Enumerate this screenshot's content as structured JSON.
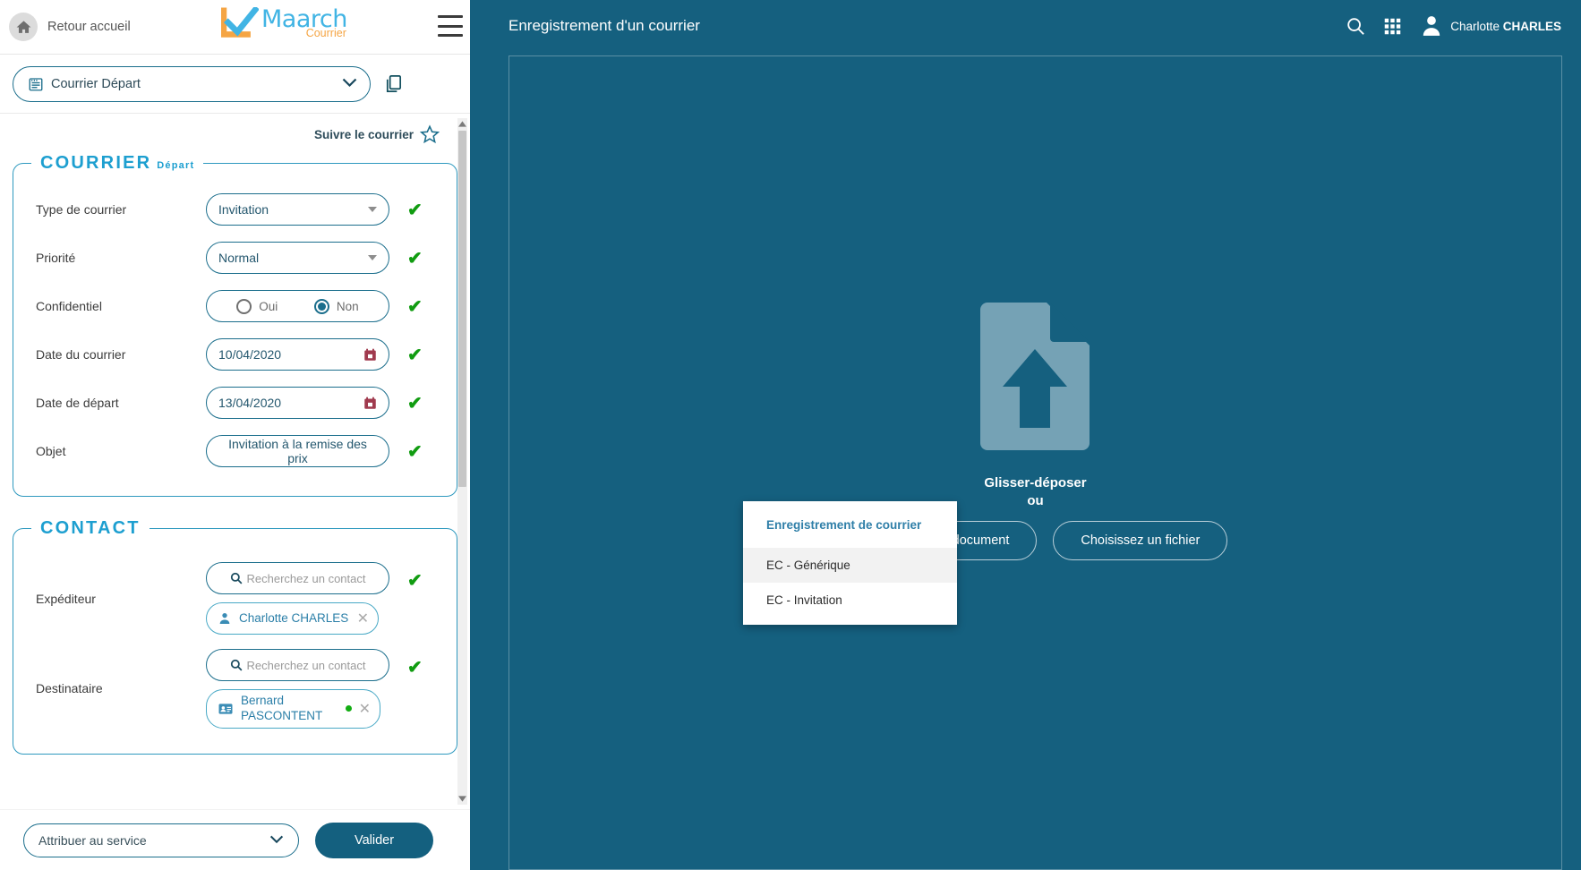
{
  "left_panel": {
    "home_button_label": "Retour accueil",
    "logo": {
      "brand": "Maarch",
      "sub": "Courrier"
    },
    "type_selector": {
      "value": "Courrier Départ"
    },
    "follow": {
      "label": "Suivre le courrier"
    },
    "sections": [
      {
        "title": "COURRIER",
        "subtitle": "Départ",
        "fields": [
          {
            "label": "Type de courrier",
            "kind": "select",
            "value": "Invitation",
            "valid": "✔"
          },
          {
            "label": "Priorité",
            "kind": "select",
            "value": "Normal",
            "valid": "✔"
          },
          {
            "label": "Confidentiel",
            "kind": "radio",
            "options": [
              "Oui",
              "Non"
            ],
            "selected": "Non",
            "valid": "✔"
          },
          {
            "label": "Date du courrier",
            "kind": "date",
            "value": "10/04/2020",
            "valid": "✔"
          },
          {
            "label": "Date de départ",
            "kind": "date",
            "value": "13/04/2020",
            "valid": "✔"
          },
          {
            "label": "Objet",
            "kind": "text",
            "value": "Invitation à la remise des prix",
            "valid": "✔"
          }
        ]
      },
      {
        "title": "CONTACT",
        "subtitle": "",
        "rows": [
          {
            "label": "Expéditeur",
            "search_placeholder": "Recherchez un contact",
            "valid": "✔",
            "chip": {
              "name": "Charlotte CHARLES",
              "icon": "person-icon",
              "close": "✕",
              "has_dot": false
            }
          },
          {
            "label": "Destinataire",
            "search_placeholder": "Recherchez un contact",
            "valid": "✔",
            "chip": {
              "name": "Bernard PASCONTENT",
              "icon": "contact-card-icon",
              "close": "✕",
              "has_dot": true
            }
          }
        ]
      }
    ],
    "bottom": {
      "assign_label": "Attribuer au service",
      "validate_label": "Valider"
    }
  },
  "right_panel": {
    "title": "Enregistrement d'un courrier",
    "user": {
      "first": "Charlotte ",
      "last": "CHARLES"
    },
    "dropzone": {
      "drag_text": "Glisser-déposer",
      "or_text": "ou",
      "hidden_button_label": "Numériser un document",
      "choose_file_label": "Choisissez un fichier"
    }
  },
  "menu": {
    "title": "Enregistrement de courrier",
    "items": [
      {
        "label": "EC - Générique",
        "highlighted": true
      },
      {
        "label": "EC - Invitation",
        "highlighted": false
      }
    ]
  },
  "colors": {
    "teal_bg": "#15607F",
    "accent_blue": "#1d9fd0",
    "border_blue": "#1b6e8c",
    "valid_green": "#119c11",
    "logo_blue": "#41b4e4",
    "logo_orange": "#f5a544",
    "upload_icon": "#75a2b5"
  }
}
